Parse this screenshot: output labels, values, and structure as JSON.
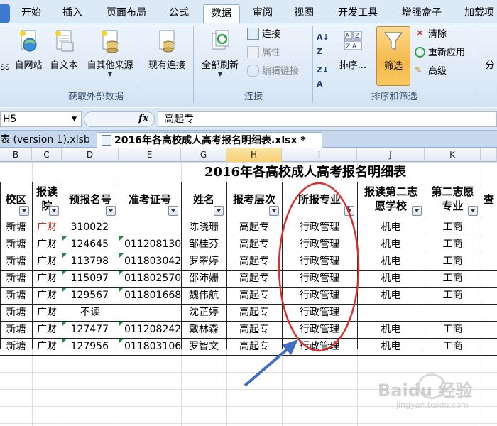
{
  "ribbon_tabs": [
    "开始",
    "插入",
    "页面布局",
    "公式",
    "数据",
    "审阅",
    "视图",
    "开发工具",
    "增强盒子",
    "加载项"
  ],
  "active_tab": "数据",
  "groups": {
    "external": {
      "label": "获取外部数据",
      "buttons": [
        {
          "label": "ss",
          "icon": "access-icon"
        },
        {
          "label": "自网站",
          "icon": "web-icon"
        },
        {
          "label": "自文本",
          "icon": "text-file-icon"
        },
        {
          "label": "自其他来源",
          "icon": "other-sources-icon"
        },
        {
          "label": "现有连接",
          "icon": "existing-connections-icon"
        }
      ]
    },
    "connections": {
      "label": "连接",
      "refresh_all": "全部刷新",
      "items": [
        "连接",
        "属性",
        "编辑链接"
      ]
    },
    "sort_filter": {
      "label": "排序和筛选",
      "sort": "排序...",
      "filter": "筛选",
      "items": [
        "清除",
        "重新应用",
        "高级"
      ]
    },
    "partial": {
      "label": "分"
    }
  },
  "colors": {
    "accent": "#f5b94a",
    "ribbon": "#dce9f7",
    "highlight_circle": "#d6302f",
    "arrow": "#3f6fc4"
  },
  "name_box": "H5",
  "fx_symbol": "fx",
  "formula_value": "高起专",
  "workbook_tabs": [
    "表 (version 1).xlsb *",
    "2016年各高校成人高考报名明细表.xlsx *"
  ],
  "columns": [
    "B",
    "C",
    "D",
    "E",
    "G",
    "H",
    "I",
    "J",
    "K",
    ""
  ],
  "sheet": {
    "title": "2016年各高校成人高考报名明细表",
    "headers": [
      {
        "text": "校区",
        "filter": true
      },
      {
        "text": "报读\n院",
        "filter": true
      },
      {
        "text": "预报名号",
        "filter": true
      },
      {
        "text": "准考证号",
        "filter": true
      },
      {
        "text": "姓名",
        "filter": true
      },
      {
        "text": "报考层次",
        "filter": true
      },
      {
        "text": "所报专业",
        "filter": true,
        "active_filter": true
      },
      {
        "text": "报读第二志\n愿学校",
        "filter": true
      },
      {
        "text": "第二志愿\n专业",
        "filter": true
      },
      {
        "text": "查",
        "filter": false
      }
    ],
    "rows": [
      [
        "新塘",
        "广财",
        "310022",
        "",
        "陈晓珊",
        "高起专",
        "行政管理",
        "机电",
        "工商"
      ],
      [
        "新塘",
        "广财",
        "124645",
        "011208130",
        "邹桂芬",
        "高起专",
        "行政管理",
        "机电",
        "工商"
      ],
      [
        "新塘",
        "广财",
        "113798",
        "011803042",
        "罗翠婷",
        "高起专",
        "行政管理",
        "机电",
        "工商"
      ],
      [
        "新塘",
        "广财",
        "115097",
        "011802570",
        "邵沛姗",
        "高起专",
        "行政管理",
        "机电",
        "工商"
      ],
      [
        "新塘",
        "广财",
        "129567",
        "011801668",
        "魏伟航",
        "高起专",
        "行政管理",
        "机电",
        "工商"
      ],
      [
        "新塘",
        "广财",
        "不读",
        "",
        "沈芷婷",
        "高起专",
        "行政管理",
        "",
        ""
      ],
      [
        "新塘",
        "广财",
        "127477",
        "011208242",
        "戴林森",
        "高起专",
        "行政管理",
        "机电",
        "工商"
      ],
      [
        "新塘",
        "广财",
        "127956",
        "011803106",
        "罗智文",
        "高起专",
        "行政管理",
        "机电",
        "工商"
      ]
    ]
  },
  "watermark": {
    "text": "Baidu 经验",
    "sub": "jingyan.baidu.com"
  }
}
